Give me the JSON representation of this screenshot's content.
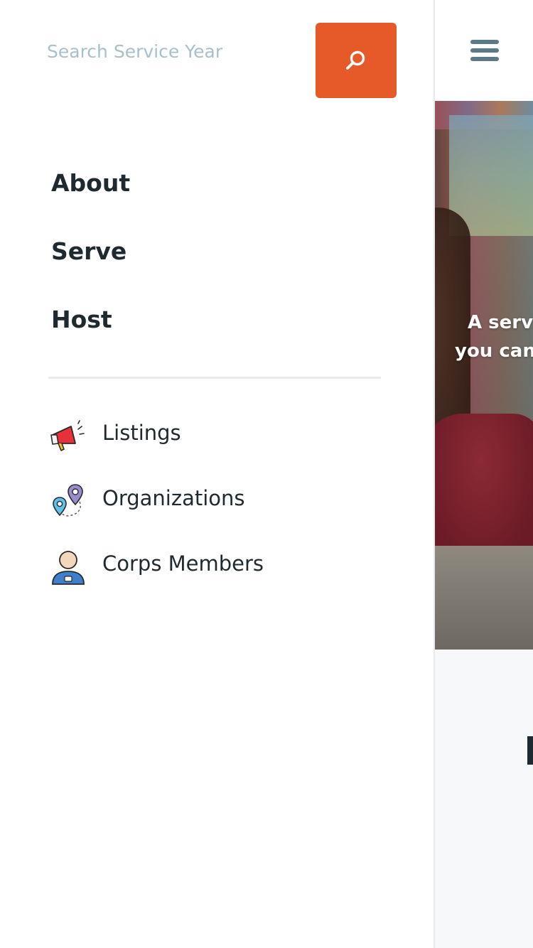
{
  "search": {
    "placeholder": "Search Service Year"
  },
  "menu": {
    "primary": [
      {
        "label": "About"
      },
      {
        "label": "Serve"
      },
      {
        "label": "Host"
      }
    ],
    "secondary": [
      {
        "label": "Listings",
        "icon": "megaphone-icon"
      },
      {
        "label": "Organizations",
        "icon": "map-pins-icon"
      },
      {
        "label": "Corps Members",
        "icon": "person-icon"
      }
    ]
  },
  "hero": {
    "caption_line1": "A servi",
    "caption_line2": "you can"
  },
  "colors": {
    "accent": "#e55a28",
    "placeholder": "#a9c0cc",
    "text": "#1f2a30",
    "hamburger": "#5c7a85",
    "divider": "#e6ebef"
  }
}
